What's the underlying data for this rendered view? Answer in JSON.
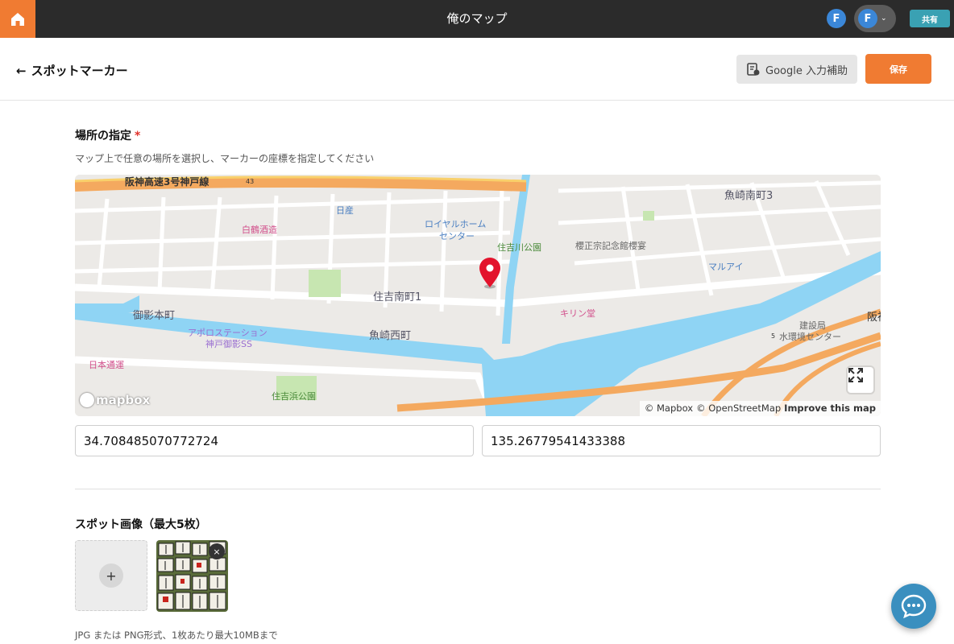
{
  "topbar": {
    "title": "俺のマップ",
    "avatar_initial": "F",
    "account_initial": "F",
    "share_label": "共有"
  },
  "header": {
    "back_label": "スポットマーカー",
    "google_label": "Google 入力補助",
    "save_label": "保存"
  },
  "location": {
    "title": "場所の指定",
    "required_mark": "*",
    "help": "マップ上で任意の場所を選択し、マーカーの座標を指定してください",
    "latitude": "34.708485070772724",
    "longitude": "135.26779541433388"
  },
  "map": {
    "labels": [
      "阪神高速3号神戸線",
      "日産",
      "白鶴酒造",
      "ロイヤルホーム",
      "センター",
      "住吉川公園",
      "櫻正宗記念館櫻宴",
      "魚崎南町3",
      "マルアイ",
      "住吉南町1",
      "御影本町",
      "キリン堂",
      "アポロステーション",
      "神戸御影SS",
      "魚崎西町",
      "建設局",
      "水環境センター",
      "阪神",
      "日本通運",
      "住吉浜公園",
      "43",
      "5"
    ],
    "logo": "mapbox",
    "attribution_mapbox": "© Mapbox",
    "attribution_osm": "© OpenStreetMap",
    "attribution_improve": "Improve this map",
    "colors": {
      "water": "#8fd4f4",
      "highway": "#f4a95f",
      "park": "#c7e6b1",
      "land": "#eceae7",
      "road": "#ffffff",
      "marker": "#e3132c"
    }
  },
  "images": {
    "title": "スポット画像（最大5枚）",
    "add_label": "+",
    "close_label": "×",
    "note": "JPG または PNG形式、1枚あたり最大10MBまで"
  }
}
